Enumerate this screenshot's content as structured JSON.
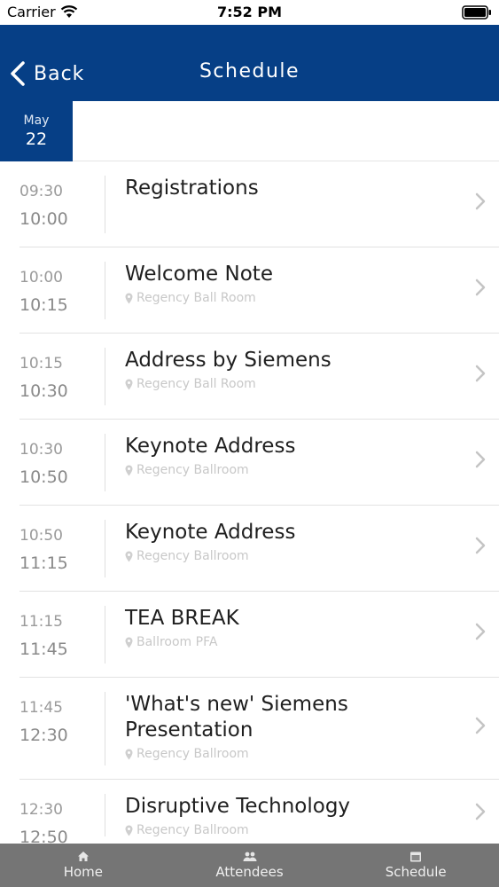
{
  "status_bar": {
    "carrier": "Carrier",
    "time": "7:52 PM"
  },
  "nav": {
    "back_label": "Back",
    "title": "Schedule"
  },
  "date_tab": {
    "month": "May",
    "day": "22"
  },
  "schedule": [
    {
      "start": "09:30",
      "end": "10:00",
      "title": "Registrations",
      "location": ""
    },
    {
      "start": "10:00",
      "end": "10:15",
      "title": "Welcome Note",
      "location": "Regency Ball Room"
    },
    {
      "start": "10:15",
      "end": "10:30",
      "title": "Address by Siemens",
      "location": "Regency Ball Room"
    },
    {
      "start": "10:30",
      "end": "10:50",
      "title": "Keynote Address",
      "location": "Regency Ballroom"
    },
    {
      "start": "10:50",
      "end": "11:15",
      "title": "Keynote Address",
      "location": "Regency Ballroom"
    },
    {
      "start": "11:15",
      "end": "11:45",
      "title": "TEA BREAK",
      "location": "Ballroom PFA"
    },
    {
      "start": "11:45",
      "end": "12:30",
      "title": "'What's new' Siemens Presentation",
      "location": "Regency Ballroom"
    },
    {
      "start": "12:30",
      "end": "12:50",
      "title": "Disruptive Technology",
      "location": "Regency Ballroom"
    }
  ],
  "tabs": [
    {
      "label": "Home",
      "icon": "home-icon"
    },
    {
      "label": "Attendees",
      "icon": "attendees-icon"
    },
    {
      "label": "Schedule",
      "icon": "schedule-icon"
    }
  ],
  "colors": {
    "brand": "#063f86",
    "tab_bar": "#757575"
  }
}
